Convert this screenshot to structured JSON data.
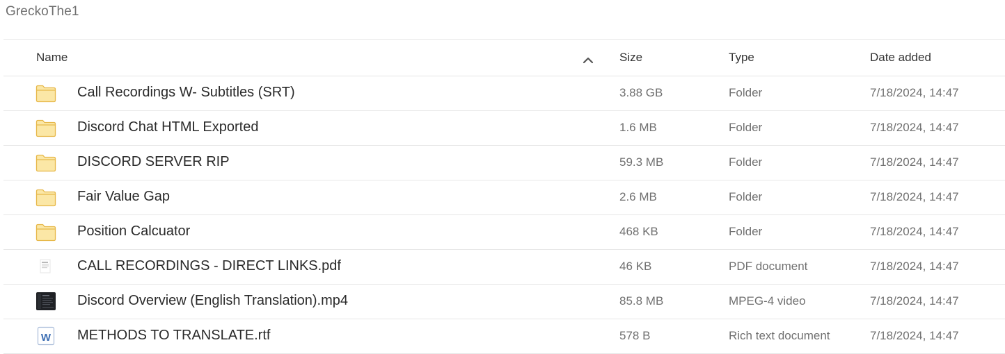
{
  "breadcrumb": "GreckoThe1",
  "columns": {
    "name": "Name",
    "size": "Size",
    "type": "Type",
    "date": "Date added"
  },
  "sort": {
    "column": "name",
    "direction": "ascending",
    "icon": "chevron-up-icon"
  },
  "files": [
    {
      "name": "Call Recordings W- Subtitles (SRT)",
      "size": "3.88 GB",
      "type": "Folder",
      "date": "7/18/2024, 14:47",
      "icon": "folder-icon"
    },
    {
      "name": "Discord Chat HTML Exported",
      "size": "1.6 MB",
      "type": "Folder",
      "date": "7/18/2024, 14:47",
      "icon": "folder-icon"
    },
    {
      "name": "DISCORD SERVER RIP",
      "size": "59.3 MB",
      "type": "Folder",
      "date": "7/18/2024, 14:47",
      "icon": "folder-icon"
    },
    {
      "name": "Fair Value Gap",
      "size": "2.6 MB",
      "type": "Folder",
      "date": "7/18/2024, 14:47",
      "icon": "folder-icon"
    },
    {
      "name": "Position Calcuator",
      "size": "468 KB",
      "type": "Folder",
      "date": "7/18/2024, 14:47",
      "icon": "folder-icon"
    },
    {
      "name": "CALL RECORDINGS - DIRECT LINKS.pdf",
      "size": "46 KB",
      "type": "PDF document",
      "date": "7/18/2024, 14:47",
      "icon": "pdf-thumbnail-icon"
    },
    {
      "name": "Discord Overview (English Translation).mp4",
      "size": "85.8 MB",
      "type": "MPEG-4 video",
      "date": "7/18/2024, 14:47",
      "icon": "video-thumbnail-icon"
    },
    {
      "name": "METHODS TO TRANSLATE.rtf",
      "size": "578 B",
      "type": "Rich text document",
      "date": "7/18/2024, 14:47",
      "icon": "word-document-icon"
    }
  ],
  "colors": {
    "folder_fill": "#fbe7a6",
    "folder_stroke": "#e7b84a",
    "word_blue": "#3b6db3"
  }
}
